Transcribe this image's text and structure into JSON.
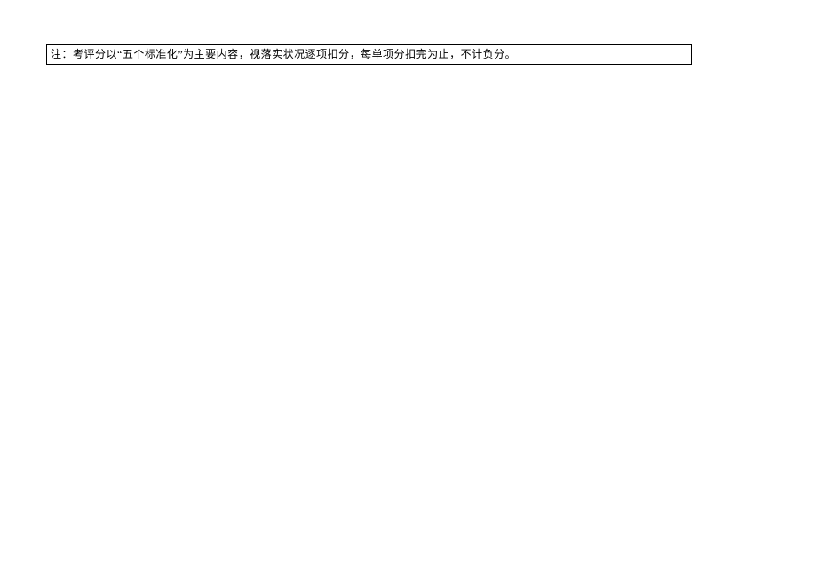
{
  "note": {
    "text": "注：考评分以“五个标准化”为主要内容，视落实状况逐项扣分，每单项分扣完为止，不计负分。"
  }
}
